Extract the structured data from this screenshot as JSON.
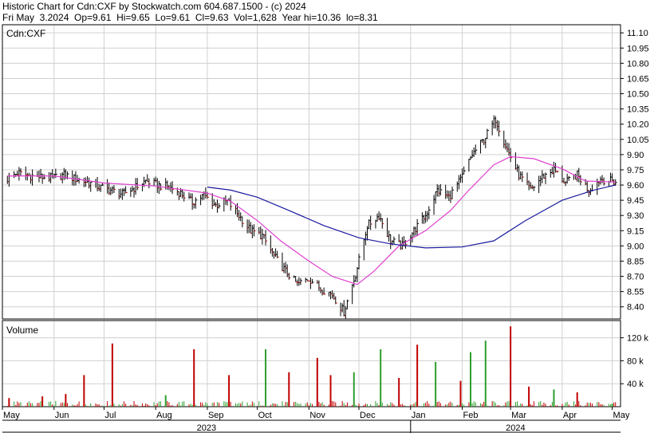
{
  "header": {
    "line1": "Historic Chart for Cdn:CXF by Stockwatch.com 604.687.1500 - (c) 2024",
    "line2": "Fri May  3.2024  Op=9.61  Hi=9.65  Lo=9.61  Cl=9.63  Vol=1,628  Year hi=10.36  lo=8.31"
  },
  "colors": {
    "up": "#2e9e2e",
    "down": "#c00000",
    "price_bar": "#000000",
    "ma_short": "#e040d0",
    "ma_long": "#1a1aa0",
    "grid": "#d0d0d0"
  },
  "chart_data": [
    {
      "type": "line",
      "label": "Cdn:CXF",
      "y_ticks": [
        8.4,
        8.55,
        8.7,
        8.85,
        9.0,
        9.15,
        9.3,
        9.45,
        9.6,
        9.75,
        9.9,
        10.05,
        10.2,
        10.35,
        10.5,
        10.65,
        10.8,
        10.95,
        11.1
      ],
      "ylim": [
        8.28,
        11.18
      ],
      "x_months": [
        "May",
        "Jun",
        "Jul",
        "Aug",
        "Sep",
        "Oct",
        "Nov",
        "Dec",
        "Jan",
        "Feb",
        "Mar",
        "Apr",
        "May"
      ],
      "x_years": [
        "2023",
        "2024"
      ],
      "grid": true,
      "series": [
        {
          "kind": "price",
          "points": [
            [
              "2023-05-04",
              9.66
            ],
            [
              "2023-05-10",
              9.72
            ],
            [
              "2023-05-17",
              9.69
            ],
            [
              "2023-05-24",
              9.68
            ],
            [
              "2023-05-31",
              9.67
            ],
            [
              "2023-06-07",
              9.7
            ],
            [
              "2023-06-14",
              9.66
            ],
            [
              "2023-06-21",
              9.63
            ],
            [
              "2023-06-28",
              9.58
            ],
            [
              "2023-07-05",
              9.55
            ],
            [
              "2023-07-12",
              9.51
            ],
            [
              "2023-07-19",
              9.57
            ],
            [
              "2023-07-26",
              9.64
            ],
            [
              "2023-08-02",
              9.6
            ],
            [
              "2023-08-09",
              9.58
            ],
            [
              "2023-08-16",
              9.52
            ],
            [
              "2023-08-23",
              9.43
            ],
            [
              "2023-08-30",
              9.5
            ],
            [
              "2023-09-06",
              9.4
            ],
            [
              "2023-09-13",
              9.44
            ],
            [
              "2023-09-20",
              9.3
            ],
            [
              "2023-09-27",
              9.15
            ],
            [
              "2023-10-04",
              9.1
            ],
            [
              "2023-10-11",
              8.9
            ],
            [
              "2023-10-18",
              8.75
            ],
            [
              "2023-10-25",
              8.62
            ],
            [
              "2023-11-01",
              8.68
            ],
            [
              "2023-11-08",
              8.58
            ],
            [
              "2023-11-15",
              8.52
            ],
            [
              "2023-11-22",
              8.35
            ],
            [
              "2023-11-29",
              8.72
            ],
            [
              "2023-12-06",
              9.2
            ],
            [
              "2023-12-13",
              9.3
            ],
            [
              "2023-12-20",
              9.05
            ],
            [
              "2023-12-27",
              9.0
            ],
            [
              "2024-01-03",
              9.15
            ],
            [
              "2024-01-10",
              9.3
            ],
            [
              "2024-01-17",
              9.55
            ],
            [
              "2024-01-24",
              9.48
            ],
            [
              "2024-01-31",
              9.65
            ],
            [
              "2024-02-07",
              9.9
            ],
            [
              "2024-02-14",
              10.05
            ],
            [
              "2024-02-21",
              10.25
            ],
            [
              "2024-02-28",
              9.95
            ],
            [
              "2024-03-06",
              9.7
            ],
            [
              "2024-03-13",
              9.55
            ],
            [
              "2024-03-20",
              9.68
            ],
            [
              "2024-03-27",
              9.75
            ],
            [
              "2024-04-03",
              9.62
            ],
            [
              "2024-04-10",
              9.7
            ],
            [
              "2024-04-17",
              9.55
            ],
            [
              "2024-04-24",
              9.66
            ],
            [
              "2024-05-03",
              9.63
            ]
          ]
        },
        {
          "kind": "ma_short",
          "points": [
            [
              "2023-05-04",
              9.69
            ],
            [
              "2023-06-01",
              9.69
            ],
            [
              "2023-07-01",
              9.62
            ],
            [
              "2023-08-01",
              9.59
            ],
            [
              "2023-09-01",
              9.52
            ],
            [
              "2023-09-15",
              9.44
            ],
            [
              "2023-10-01",
              9.25
            ],
            [
              "2023-10-15",
              9.05
            ],
            [
              "2023-11-01",
              8.85
            ],
            [
              "2023-11-15",
              8.7
            ],
            [
              "2023-11-30",
              8.62
            ],
            [
              "2023-12-10",
              8.75
            ],
            [
              "2023-12-25",
              9.0
            ],
            [
              "2024-01-10",
              9.15
            ],
            [
              "2024-01-25",
              9.35
            ],
            [
              "2024-02-05",
              9.55
            ],
            [
              "2024-02-20",
              9.8
            ],
            [
              "2024-03-01",
              9.88
            ],
            [
              "2024-03-15",
              9.86
            ],
            [
              "2024-04-01",
              9.76
            ],
            [
              "2024-04-15",
              9.64
            ],
            [
              "2024-05-03",
              9.63
            ]
          ]
        },
        {
          "kind": "ma_long",
          "points": [
            [
              "2023-09-01",
              9.58
            ],
            [
              "2023-09-15",
              9.55
            ],
            [
              "2023-10-01",
              9.48
            ],
            [
              "2023-10-20",
              9.35
            ],
            [
              "2023-11-10",
              9.2
            ],
            [
              "2023-12-01",
              9.08
            ],
            [
              "2023-12-20",
              9.02
            ],
            [
              "2024-01-10",
              8.98
            ],
            [
              "2024-02-01",
              8.99
            ],
            [
              "2024-02-20",
              9.05
            ],
            [
              "2024-03-10",
              9.25
            ],
            [
              "2024-04-01",
              9.45
            ],
            [
              "2024-04-20",
              9.55
            ],
            [
              "2024-05-03",
              9.6
            ]
          ]
        }
      ]
    },
    {
      "type": "bar",
      "label": "Volume",
      "y_ticks": [
        "40 k",
        "80 k",
        "120 k"
      ],
      "ylim": [
        0,
        150000
      ],
      "spikes": [
        [
          "2023-05-05",
          15000,
          "down"
        ],
        [
          "2023-05-25",
          18000,
          "down"
        ],
        [
          "2023-06-08",
          22000,
          "down"
        ],
        [
          "2023-06-19",
          55000,
          "down"
        ],
        [
          "2023-07-06",
          110000,
          "down"
        ],
        [
          "2023-08-07",
          20000,
          "up"
        ],
        [
          "2023-08-24",
          100000,
          "down"
        ],
        [
          "2023-09-14",
          55000,
          "down"
        ],
        [
          "2023-10-06",
          100000,
          "up"
        ],
        [
          "2023-10-20",
          60000,
          "down"
        ],
        [
          "2023-11-06",
          85000,
          "down"
        ],
        [
          "2023-11-14",
          55000,
          "down"
        ],
        [
          "2023-11-28",
          60000,
          "up"
        ],
        [
          "2023-12-14",
          100000,
          "up"
        ],
        [
          "2023-12-25",
          50000,
          "down"
        ],
        [
          "2024-01-05",
          108000,
          "down"
        ],
        [
          "2024-01-16",
          78000,
          "up"
        ],
        [
          "2024-01-31",
          45000,
          "down"
        ],
        [
          "2024-02-06",
          95000,
          "up"
        ],
        [
          "2024-02-15",
          115000,
          "up"
        ],
        [
          "2024-03-01",
          140000,
          "down"
        ],
        [
          "2024-03-12",
          35000,
          "down"
        ],
        [
          "2024-03-27",
          30000,
          "up"
        ],
        [
          "2024-04-10",
          25000,
          "down"
        ],
        [
          "2024-05-01",
          5000,
          "up"
        ]
      ]
    }
  ]
}
